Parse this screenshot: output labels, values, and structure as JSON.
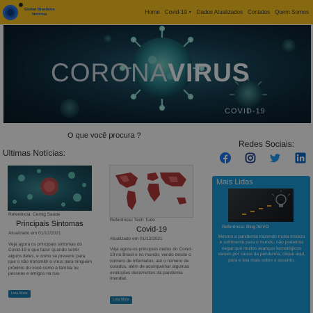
{
  "navbar": {
    "brand_line1": "Global Brasileira",
    "brand_line2": "Notícias",
    "links": [
      {
        "label": "Home"
      },
      {
        "label": "Covid-19"
      },
      {
        "label": "Dados Atualizados"
      },
      {
        "label": "Contatos"
      },
      {
        "label": "Quem Somos"
      }
    ]
  },
  "hero": {
    "title_light": "CORONA",
    "title_bold": "VIRUS",
    "subtitle": "COVID-19"
  },
  "search": {
    "heading": "O que você procura ?"
  },
  "news": {
    "heading": "Ultimas Notícias:",
    "cards": [
      {
        "reference": "Referência: Cemig Saúde",
        "title": "Principais Sintomas",
        "date": "Atualizado em 01/12/2021",
        "text": "Veja agora os principais sintomas do Covid-19 e que fazer quando sentir alguns deles, e como se prevenir para que o não transmitir o vírus para ninguém próximo do você como a família ou pessoas e amigos na rua.",
        "button": "Leia Mais"
      },
      {
        "reference": "Referência: Tech Tudo",
        "title": "Covid-19",
        "date": "Atualizado em 01/12/2021",
        "text": "Veja agora os principais dados do Covid-19 no Brasil e no mundo, vendo desde o número de infectados, até o número de curados, além de acompanhar algumas evoluções decorrentes da pandemia mundial.",
        "button": "Leia Mais"
      }
    ]
  },
  "social": {
    "heading": "Redes Sociais:",
    "icons": [
      "facebook-icon",
      "instagram-icon",
      "twitter-icon",
      "linkedin-icon"
    ]
  },
  "most_read": {
    "heading": "Mais Lidas",
    "reference": "Referência: Blog AEVO",
    "text": "Mesmo a pandemia trazendo muita tristeza e sofrimento para o mundo, não podemos negar que muitos avanços tecnológicos vieram por causa da pandemia, clique aqui, para e leia mais sobre o assunto."
  },
  "colors": {
    "navbar": "#f7c320",
    "most_read_bg": "#1a9ad6",
    "button": "#1d7fb0"
  }
}
